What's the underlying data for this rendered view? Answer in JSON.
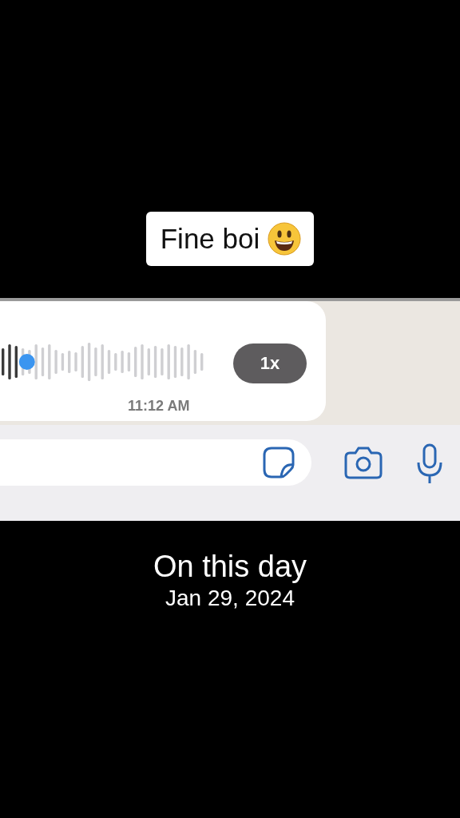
{
  "caption": {
    "text": "Fine boi"
  },
  "voice_message": {
    "level": 0.1,
    "speed": "1x",
    "time": "11:12 AM"
  },
  "footer": {
    "title": "On this day",
    "date": "Jan 29, 2024"
  }
}
